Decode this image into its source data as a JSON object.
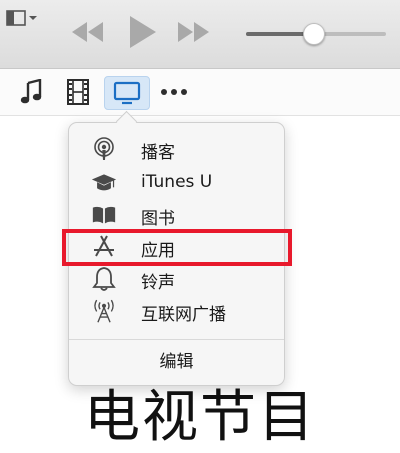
{
  "toolbar": {
    "menu_icon": "sidebar-menu-icon",
    "rewind_icon": "rewind-icon",
    "play_icon": "play-icon",
    "forward_icon": "fast-forward-icon",
    "volume_level": 0.48,
    "colors": {
      "button_gray": "#a9a9a9",
      "background": "#e4e4e4"
    }
  },
  "media_kinds": [
    {
      "name": "music",
      "icon": "music-note-icon"
    },
    {
      "name": "movies",
      "icon": "film-icon"
    },
    {
      "name": "tv-shows",
      "icon": "tv-icon",
      "active": true
    },
    {
      "name": "more",
      "icon": "more-dots-icon"
    }
  ],
  "popover": {
    "items": [
      {
        "label": "播客",
        "icon": "podcast-icon"
      },
      {
        "label": "iTunes U",
        "icon": "graduation-cap-icon"
      },
      {
        "label": "图书",
        "icon": "book-icon"
      },
      {
        "label": "应用",
        "icon": "app-store-icon",
        "highlighted": true
      },
      {
        "label": "铃声",
        "icon": "bell-icon"
      },
      {
        "label": "互联网广播",
        "icon": "radio-antenna-icon"
      }
    ],
    "edit_label": "编辑",
    "highlight_color": "#e8192c"
  },
  "page_title": "电视节目"
}
